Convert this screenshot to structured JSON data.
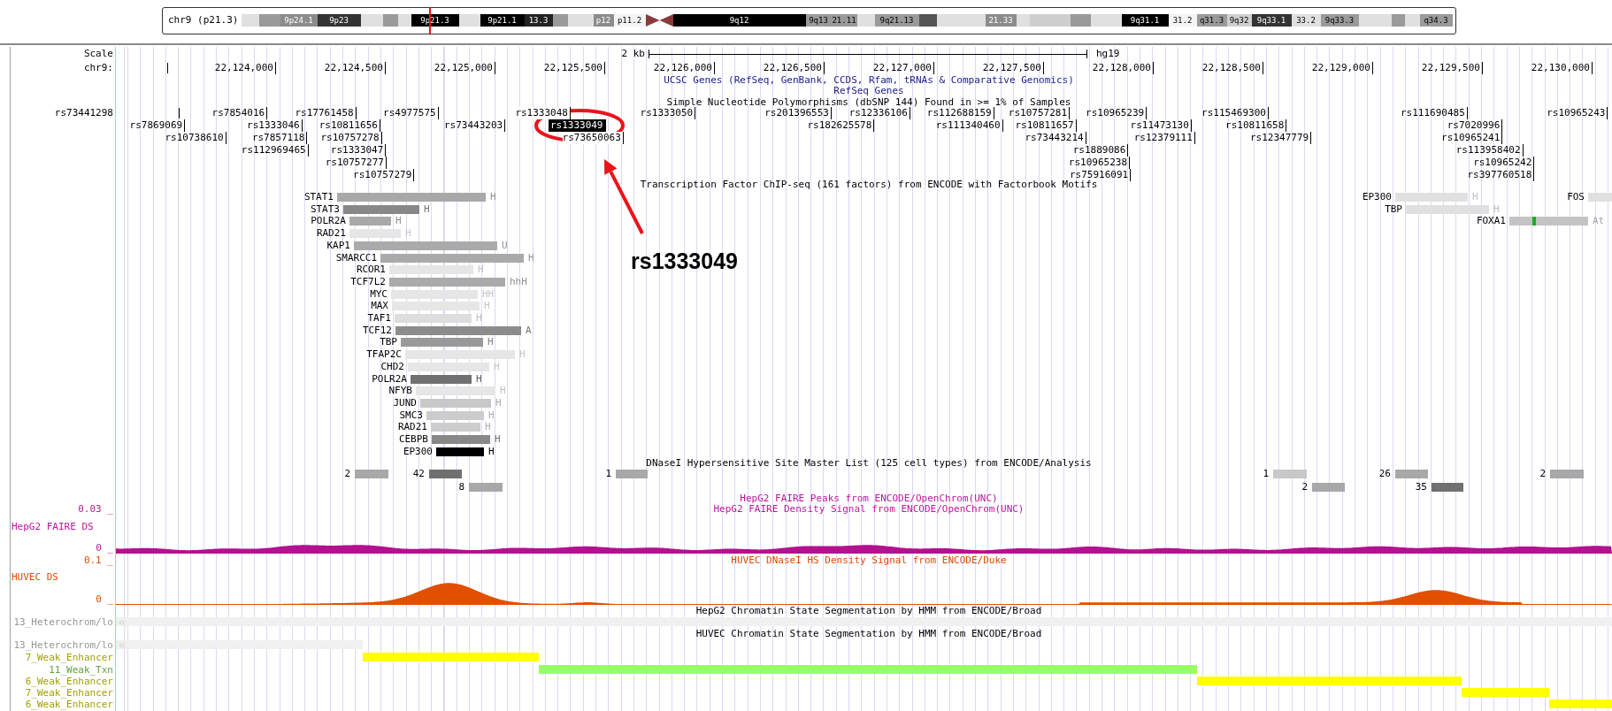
{
  "ideogram": {
    "label": "chr9 (p21.3)",
    "bands": [
      {
        "kind": "band",
        "color": "#e0e0e0"
      },
      {
        "kind": "band",
        "color": "#9a9a9a"
      },
      {
        "kind": "band",
        "color": "#8c8c8c",
        "label": "9p24.1"
      },
      {
        "kind": "band",
        "color": "#333333",
        "label": "9p23"
      },
      {
        "kind": "band",
        "color": "#e0e0e0"
      },
      {
        "kind": "band",
        "color": "#9a9a9a"
      },
      {
        "kind": "band",
        "color": "#e0e0e0"
      },
      {
        "kind": "band",
        "color": "#000000",
        "label": "9p21.3"
      },
      {
        "kind": "band",
        "color": "#e0e0e0"
      },
      {
        "kind": "band",
        "color": "#000000",
        "label": "9p21.1"
      },
      {
        "kind": "band",
        "color": "#222222",
        "label": "13.3"
      },
      {
        "kind": "band",
        "color": "#9a9a9a"
      },
      {
        "kind": "band",
        "color": "#e0e0e0"
      },
      {
        "kind": "band",
        "color": "#8c8c8c",
        "label": "p12"
      },
      {
        "kind": "band",
        "color": "#f4f4f4",
        "label": "p11.2"
      },
      {
        "kind": "centromere",
        "color": "#8b3a3a"
      },
      {
        "kind": "band",
        "color": "#000000",
        "label": "9q12"
      },
      {
        "kind": "band",
        "color": "#9a9a9a",
        "label": "9q13"
      },
      {
        "kind": "band",
        "color": "#9a9a9a",
        "label": "21.11"
      },
      {
        "kind": "band",
        "color": "#e0e0e0"
      },
      {
        "kind": "band",
        "color": "#9a9a9a",
        "label": "9q21.13"
      },
      {
        "kind": "band",
        "color": "#555555"
      },
      {
        "kind": "band",
        "color": "#e0e0e0"
      },
      {
        "kind": "band",
        "color": "#8c8c8c",
        "label": "21.33"
      },
      {
        "kind": "band",
        "color": "#e0e0e0"
      },
      {
        "kind": "band",
        "color": "#cfcfcf"
      },
      {
        "kind": "band",
        "color": "#9a9a9a"
      },
      {
        "kind": "band",
        "color": "#e0e0e0"
      },
      {
        "kind": "band",
        "color": "#000000",
        "label": "9q31.1"
      },
      {
        "kind": "band",
        "color": "#f4f4f4",
        "label": "31.2"
      },
      {
        "kind": "band",
        "color": "#9a9a9a",
        "label": "q31.3"
      },
      {
        "kind": "band",
        "color": "#cfcfcf",
        "label": "9q32"
      },
      {
        "kind": "band",
        "color": "#333333",
        "label": "9q33.1"
      },
      {
        "kind": "band",
        "color": "#e0e0e0",
        "label": "33.2"
      },
      {
        "kind": "band",
        "color": "#9a9a9a",
        "label": "9q33.3"
      },
      {
        "kind": "band",
        "color": "#e0e0e0"
      },
      {
        "kind": "band",
        "color": "#9a9a9a"
      },
      {
        "kind": "band",
        "color": "#e0e0e0"
      },
      {
        "kind": "band",
        "color": "#9a9a9a",
        "label": "q34.3"
      }
    ]
  },
  "scale": {
    "label": "Scale",
    "length": "2 kb",
    "assembly": "hg19"
  },
  "ruler": {
    "label": "chr9:",
    "ticks": [
      "22,124,000",
      "22,124,500",
      "22,125,000",
      "22,125,500",
      "22,126,000",
      "22,126,500",
      "22,127,000",
      "22,127,500",
      "22,128,000",
      "22,128,500",
      "22,129,000",
      "22,129,500",
      "22,130,000"
    ]
  },
  "genes_track": {
    "titles": [
      "UCSC Genes (RefSeq, GenBank, CCDS, Rfam, tRNAs & Comparative Genomics)",
      "RefSeq Genes"
    ]
  },
  "snp_track": {
    "title": "Simple Nucleotide Polymorphisms (dbSNP 144) Found in >= 1% of Samples",
    "snps": [
      {
        "name": "rs73441298",
        "highlighted": false
      },
      {
        "name": "rs7854016",
        "highlighted": false
      },
      {
        "name": "rs17761458",
        "highlighted": false
      },
      {
        "name": "rs4977575",
        "highlighted": false
      },
      {
        "name": "rs1333048",
        "highlighted": false
      },
      {
        "name": "rs1333050",
        "highlighted": false
      },
      {
        "name": "rs201396553",
        "highlighted": false
      },
      {
        "name": "rs12336106",
        "highlighted": false
      },
      {
        "name": "rs112688159",
        "highlighted": false
      },
      {
        "name": "rs10757281",
        "highlighted": false
      },
      {
        "name": "rs10965239",
        "highlighted": false
      },
      {
        "name": "rs115469300",
        "highlighted": false
      },
      {
        "name": "rs111690485",
        "highlighted": false
      },
      {
        "name": "rs10965243",
        "highlighted": false
      },
      {
        "name": "rs7869069",
        "highlighted": false
      },
      {
        "name": "rs1333046",
        "highlighted": false
      },
      {
        "name": "rs10811656",
        "highlighted": false
      },
      {
        "name": "rs73443203",
        "highlighted": false
      },
      {
        "name": "rs1333049",
        "highlighted": true
      },
      {
        "name": "rs182625578",
        "highlighted": false
      },
      {
        "name": "rs111340460",
        "highlighted": false
      },
      {
        "name": "rs10811657",
        "highlighted": false
      },
      {
        "name": "rs11473130",
        "highlighted": false
      },
      {
        "name": "rs10811658",
        "highlighted": false
      },
      {
        "name": "rs7020996",
        "highlighted": false
      },
      {
        "name": "rs10738610",
        "highlighted": false
      },
      {
        "name": "rs7857118",
        "highlighted": false
      },
      {
        "name": "rs10757278",
        "highlighted": false
      },
      {
        "name": "rs73650063",
        "highlighted": false
      },
      {
        "name": "rs73443214",
        "highlighted": false
      },
      {
        "name": "rs12379111",
        "highlighted": false
      },
      {
        "name": "rs12347779",
        "highlighted": false
      },
      {
        "name": "rs10965241",
        "highlighted": false
      },
      {
        "name": "rs112969465",
        "highlighted": false
      },
      {
        "name": "rs1333047",
        "highlighted": false
      },
      {
        "name": "rs1889086",
        "highlighted": false
      },
      {
        "name": "rs113958402",
        "highlighted": false
      },
      {
        "name": "rs10757277",
        "highlighted": false
      },
      {
        "name": "rs10965238",
        "highlighted": false
      },
      {
        "name": "rs10965242",
        "highlighted": false
      },
      {
        "name": "rs10757279",
        "highlighted": false
      },
      {
        "name": "rs75916091",
        "highlighted": false
      },
      {
        "name": "rs397760518",
        "highlighted": false
      }
    ]
  },
  "tf_track": {
    "title": "Transcription Factor ChIP-seq (161 factors) from ENCODE with Factorbook Motifs",
    "factors": [
      {
        "name": "STAT1",
        "color": "#a8a8a8",
        "cells": "H",
        "motif": false
      },
      {
        "name": "EP300",
        "color": "#e0e0e0",
        "cells": "H",
        "motif": false
      },
      {
        "name": "FOS",
        "color": "#e0e0e0",
        "motif": false
      },
      {
        "name": "STAT3",
        "color": "#888888",
        "cells": "H",
        "motif": false
      },
      {
        "name": "TBP",
        "color": "#e0e0e0",
        "cells": "H",
        "motif": false
      },
      {
        "name": "POLR2A",
        "color": "#a8a8a8",
        "cells": "H",
        "motif": false
      },
      {
        "name": "FOXA1",
        "color": "#c4c4c4",
        "cells": "At",
        "motif": true
      },
      {
        "name": "RAD21",
        "color": "#e6e6e6",
        "cells": "H",
        "motif": false
      },
      {
        "name": "KAP1",
        "color": "#aaaaaa",
        "cells": "U",
        "motif": false
      },
      {
        "name": "SMARCC1",
        "color": "#aaaaaa",
        "cells": "H",
        "motif": false
      },
      {
        "name": "RCOR1",
        "color": "#e6e6e6",
        "cells": "H",
        "motif": false
      },
      {
        "name": "TCF7L2",
        "color": "#aaaaaa",
        "cells": "hhH",
        "motif": false
      },
      {
        "name": "MYC",
        "color": "#e6e6e6",
        "cells": "HH",
        "motif": false
      },
      {
        "name": "MAX",
        "color": "#e6e6e6",
        "cells": "H",
        "motif": false
      },
      {
        "name": "TAF1",
        "color": "#dddddd",
        "cells": "H",
        "motif": false
      },
      {
        "name": "TCF12",
        "color": "#8c8c8c",
        "cells": "A",
        "motif": false
      },
      {
        "name": "TBP",
        "color": "#999999",
        "cells": "H",
        "motif": false
      },
      {
        "name": "TFAP2C",
        "color": "#e6e6e6",
        "cells": "H",
        "motif": false
      },
      {
        "name": "CHD2",
        "color": "#e6e6e6",
        "cells": "H",
        "motif": false
      },
      {
        "name": "POLR2A",
        "color": "#707070",
        "cells": "H",
        "motif": false
      },
      {
        "name": "NFYB",
        "color": "#e6e6e6",
        "cells": "H",
        "motif": false
      },
      {
        "name": "JUND",
        "color": "#c8c8c8",
        "cells": "H",
        "motif": false
      },
      {
        "name": "SMC3",
        "color": "#cccccc",
        "cells": "H",
        "motif": false
      },
      {
        "name": "RAD21",
        "color": "#cccccc",
        "cells": "H",
        "motif": false
      },
      {
        "name": "CEBPB",
        "color": "#888888",
        "cells": "H",
        "motif": false
      },
      {
        "name": "EP300",
        "color": "#000000",
        "cells": "H",
        "motif": false
      }
    ]
  },
  "dnase_track": {
    "title": "DNaseI Hypersensitive Site Master List (125 cell types) from ENCODE/Analysis",
    "clusters": [
      {
        "count": "2",
        "color": "#a8a8a8"
      },
      {
        "count": "42",
        "color": "#707070"
      },
      {
        "count": "1",
        "color": "#a8a8a8"
      },
      {
        "count": "1",
        "color": "#c8c8c8"
      },
      {
        "count": "26",
        "color": "#a8a8a8"
      },
      {
        "count": "2",
        "color": "#a8a8a8"
      },
      {
        "count": "8",
        "color": "#a8a8a8"
      },
      {
        "count": "2",
        "color": "#a8a8a8"
      },
      {
        "count": "35",
        "color": "#707070"
      }
    ]
  },
  "faire_track": {
    "titles": [
      "HepG2 FAIRE Peaks from ENCODE/OpenChrom(UNC)",
      "HepG2 FAIRE Density Signal from ENCODE/OpenChrom(UNC)"
    ],
    "label": "HepG2 FAIRE DS",
    "max": "0.03 _",
    "min": "0 _"
  },
  "huvec_dnase_track": {
    "title": "HUVEC DNaseI HS Density Signal from ENCODE/Duke",
    "label": "HUVEC DS",
    "max": "0.1 _",
    "min": "0 _"
  },
  "hepg2_chromatin": {
    "title": "HepG2 Chromatin State Segmentation by HMM from ENCODE/Broad",
    "states": [
      {
        "label": "13_Heterochrom/lo",
        "color": "#f0f0f0"
      }
    ]
  },
  "huvec_chromatin": {
    "title": "HUVEC Chromatin State Segmentation by HMM from ENCODE/Broad",
    "states": [
      {
        "label": "13_Heterochrom/lo",
        "color": "#f0f0f0"
      },
      {
        "label": "7_Weak_Enhancer",
        "color": "#ffff00"
      },
      {
        "label": "11_Weak_Txn",
        "color": "#99ff66"
      },
      {
        "label": "6_Weak_Enhancer",
        "color": "#ffff00"
      },
      {
        "label": "7_Weak_Enhancer",
        "color": "#ffff00"
      },
      {
        "label": "6_Weak_Enhancer",
        "color": "#ffff00"
      }
    ]
  },
  "annotation": {
    "label": "rs1333049"
  }
}
